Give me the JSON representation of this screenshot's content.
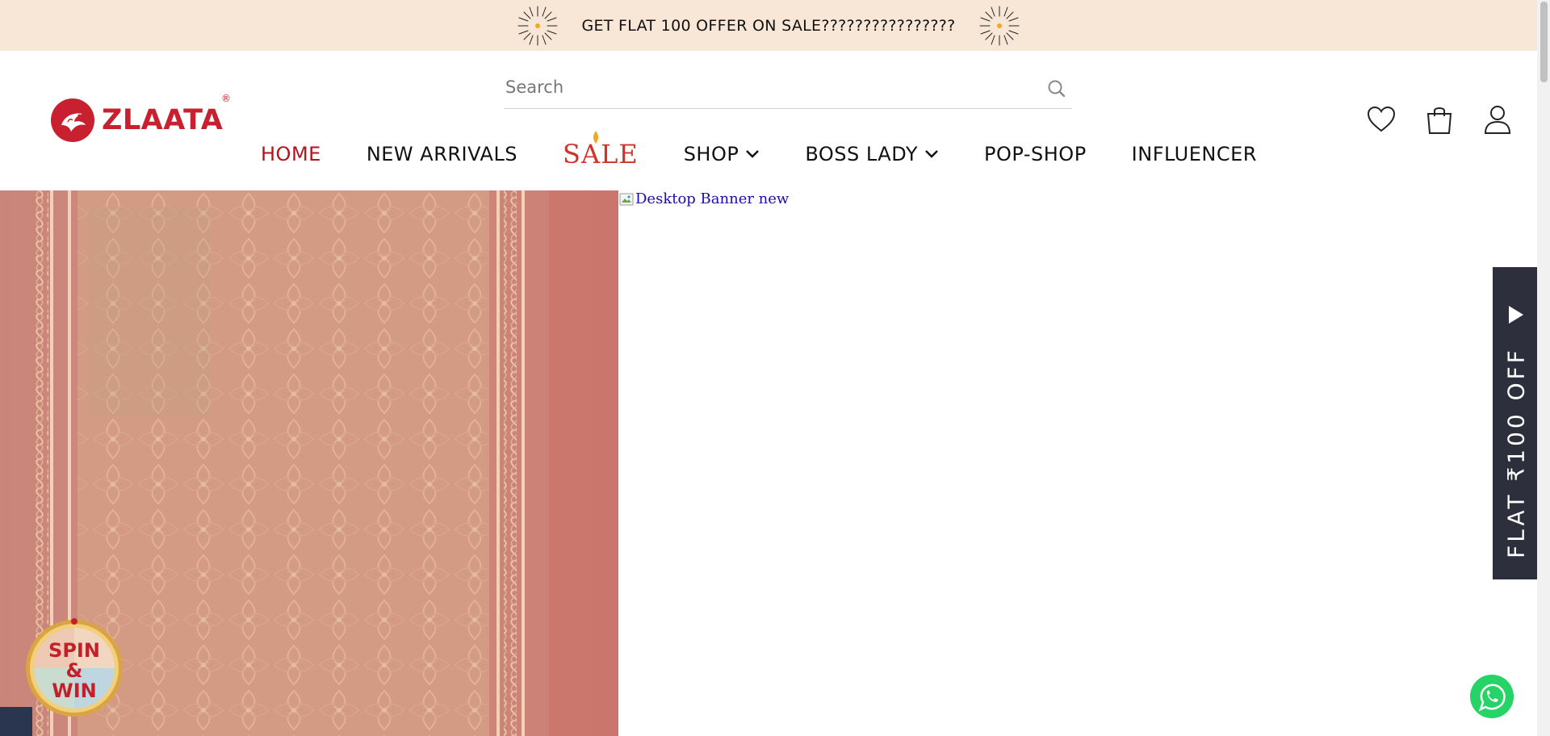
{
  "announcement": {
    "text": "GET FLAT 100 OFFER ON SALE????????????????"
  },
  "brand": {
    "name": "ZLAATA",
    "reg": "®",
    "color": "#c8202f"
  },
  "search": {
    "placeholder": "Search"
  },
  "nav": {
    "home": "HOME",
    "new_arrivals": "NEW ARRIVALS",
    "sale": "SALE",
    "shop": "SHOP",
    "boss_lady": "BOSS LADY",
    "pop_shop": "POP-SHOP",
    "influencer": "INFLUENCER"
  },
  "header_icons": [
    "heart-icon",
    "bag-icon",
    "user-icon"
  ],
  "banner": {
    "alt": "Desktop Banner new"
  },
  "side_tab": {
    "text": "FLAT ₹100 OFF"
  },
  "spin_win": {
    "line1": "SPIN",
    "line2": "&",
    "line3": "WIN"
  },
  "colors": {
    "announce_bg": "#f8e6d6",
    "accent_red": "#b5121b",
    "side_tab_bg": "#2e2f3c",
    "whatsapp": "#25d366"
  }
}
